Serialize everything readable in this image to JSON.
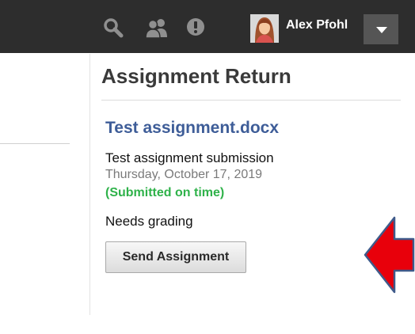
{
  "topbar": {
    "user_name": "Alex Pfohl",
    "icons": [
      "search-icon",
      "people-icon",
      "alert-icon",
      "avatar",
      "chevron-down-icon"
    ],
    "colors": {
      "background": "#2d2d2d",
      "icon": "#8f8f8f"
    }
  },
  "panel": {
    "title": "Assignment Return",
    "file_name": "Test assignment.docx",
    "description": "Test assignment submission",
    "date": "Thursday, October 17, 2019",
    "status": "(Submitted on time)",
    "grading_status": "Needs grading",
    "send_button_label": "Send Assignment",
    "colors": {
      "link": "#3e5d98",
      "status": "#2fb24a",
      "arrow_fill": "#e8000b",
      "arrow_outline": "#3f5a8a"
    }
  }
}
